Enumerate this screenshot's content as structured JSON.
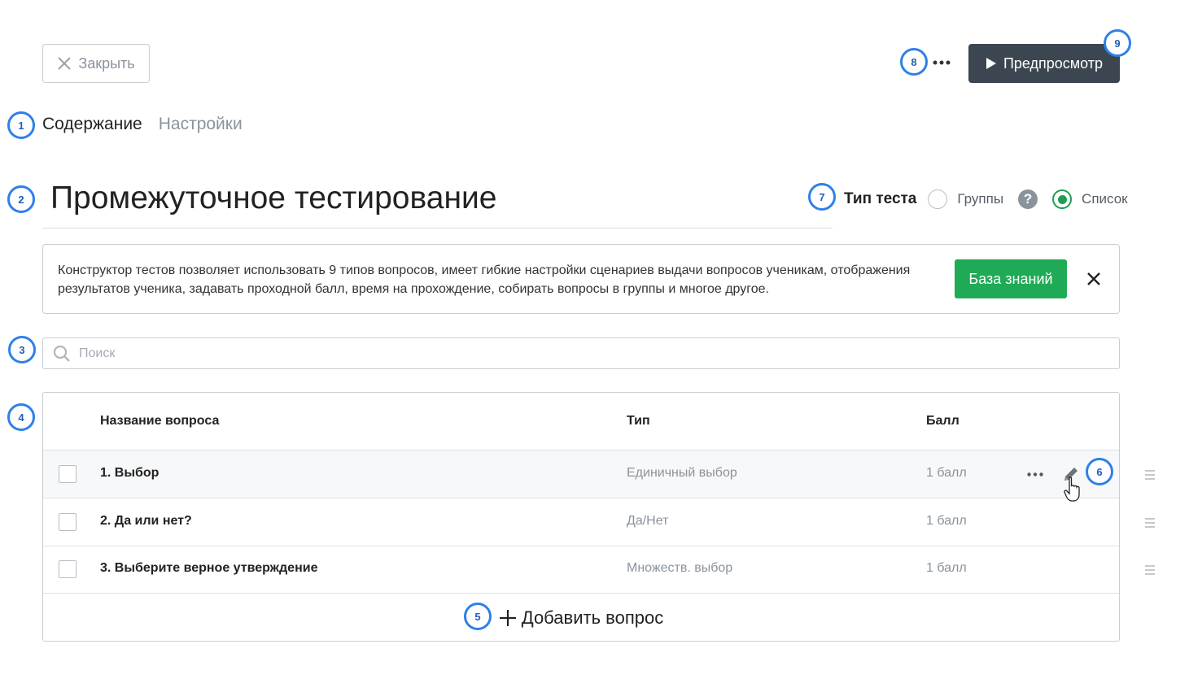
{
  "header": {
    "close_label": "Закрыть",
    "preview_label": "Предпросмотр"
  },
  "tabs": [
    {
      "label": "Содержание",
      "active": true
    },
    {
      "label": "Настройки",
      "active": false
    }
  ],
  "page_title": "Промежуточное тестирование",
  "test_type": {
    "label": "Тип теста",
    "options": [
      {
        "label": "Группы",
        "selected": false
      },
      {
        "label": "Список",
        "selected": true
      }
    ],
    "help_symbol": "?"
  },
  "info": {
    "text": "Конструктор тестов позволяет использовать 9 типов вопросов, имеет гибкие настройки сценариев выдачи вопросов ученикам, отображения результатов ученика, задавать проходной балл, время на прохождение, собирать вопросы в группы и многое другое.",
    "button_label": "База знаний"
  },
  "search": {
    "placeholder": "Поиск",
    "value": ""
  },
  "table": {
    "headers": {
      "name": "Название вопроса",
      "type": "Тип",
      "score": "Балл"
    },
    "rows": [
      {
        "name": "1. Выбор",
        "type": "Единичный выбор",
        "score": "1 балл"
      },
      {
        "name": "2. Да или нет?",
        "type": "Да/Нет",
        "score": "1 балл"
      },
      {
        "name": "3. Выберите верное утверждение",
        "type": "Множеств. выбор",
        "score": "1 балл"
      }
    ],
    "add_label": "Добавить вопрос"
  },
  "markers": [
    "1",
    "2",
    "3",
    "4",
    "5",
    "6",
    "7",
    "8",
    "9"
  ],
  "colors": {
    "accent": "#2f80e8",
    "primary_dark": "#3c4650",
    "success": "#1faa55",
    "muted": "#8a939c"
  },
  "icons": [
    "close-icon",
    "more-icon",
    "play-icon",
    "help-icon",
    "search-icon",
    "edit-icon",
    "plus-icon",
    "drag-handle-icon",
    "pointer-cursor-icon"
  ]
}
